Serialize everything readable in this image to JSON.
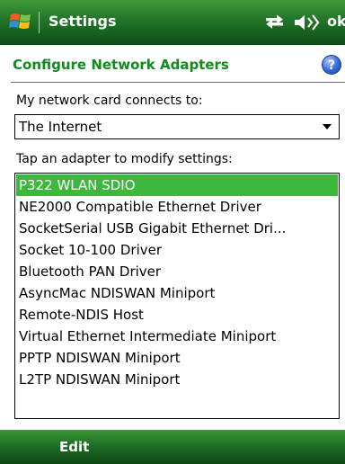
{
  "titlebar": {
    "title": "Settings",
    "ok_label": "ok"
  },
  "header": {
    "title": "Configure Network Adapters",
    "help_label": "?"
  },
  "form": {
    "connects_label": "My network card connects to:",
    "connects_value": "The Internet",
    "adapters_label": "Tap an adapter to modify settings:",
    "adapters": [
      {
        "label": "P322 WLAN SDIO",
        "selected": true
      },
      {
        "label": "NE2000 Compatible Ethernet Driver",
        "selected": false
      },
      {
        "label": "SocketSerial USB Gigabit Ethernet Dri...",
        "selected": false
      },
      {
        "label": "Socket 10-100 Driver",
        "selected": false
      },
      {
        "label": "Bluetooth PAN Driver",
        "selected": false
      },
      {
        "label": "AsyncMac NDISWAN Miniport",
        "selected": false
      },
      {
        "label": "Remote-NDIS Host",
        "selected": false
      },
      {
        "label": "Virtual Ethernet Intermediate Miniport",
        "selected": false
      },
      {
        "label": "PPTP NDISWAN Miniport",
        "selected": false
      },
      {
        "label": "L2TP NDISWAN Miniport",
        "selected": false
      }
    ]
  },
  "softkeys": {
    "left": "Edit"
  },
  "colors": {
    "accent_green": "#138a1e",
    "selection_green": "#3cb93c",
    "bar_green": "#1f6f26"
  },
  "icons": {
    "start": "windows-flag-icon",
    "connectivity": "connectivity-arrows-icon",
    "volume": "speaker-icon",
    "help": "help-icon"
  }
}
